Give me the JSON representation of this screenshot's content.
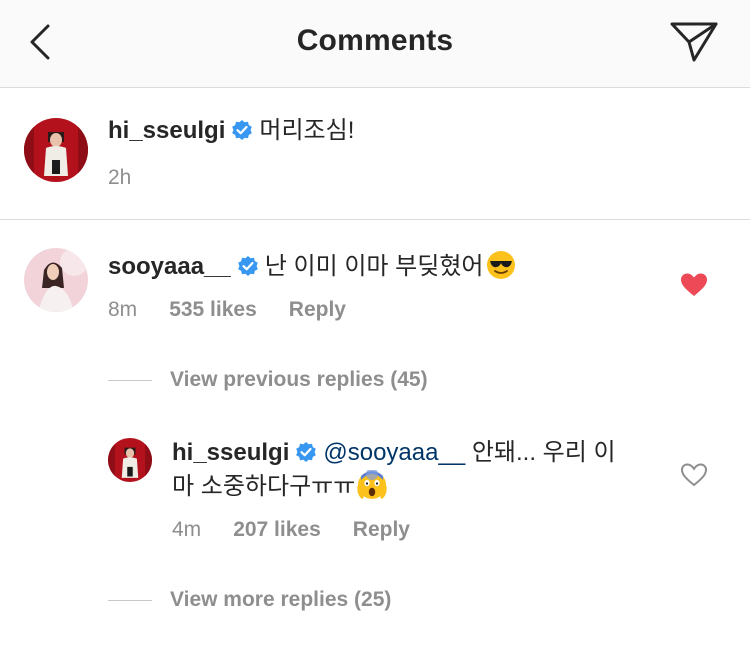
{
  "header": {
    "title": "Comments",
    "back_icon": "chevron-left-icon",
    "share_icon": "paper-plane-icon"
  },
  "caption": {
    "username": "hi_sseulgi",
    "verified": true,
    "text": "머리조심!",
    "time": "2h"
  },
  "comments": [
    {
      "username": "sooyaaa__",
      "verified": true,
      "text": "난 이미 이마 부딪혔어",
      "emoji": "sunglasses-face",
      "time": "8m",
      "likes": "535 likes",
      "reply_label": "Reply",
      "liked": true,
      "view_previous": "View previous replies (45)",
      "replies": [
        {
          "username": "hi_sseulgi",
          "verified": true,
          "mention": "@sooyaaa__",
          "text_line1": "안돼... 우리 이",
          "text_line2": "마 소중하다구ㅠㅠ",
          "emoji": "screaming-face",
          "time": "4m",
          "likes": "207 likes",
          "reply_label": "Reply",
          "liked": false
        }
      ],
      "view_more": "View more replies (25)"
    }
  ],
  "colors": {
    "header_bg": "#fafafa",
    "divider": "#dbdbdb",
    "text": "#262626",
    "muted": "#8e8e8e",
    "verified_blue": "#3897f0",
    "like_red": "#ed4956",
    "mention": "#003569"
  }
}
